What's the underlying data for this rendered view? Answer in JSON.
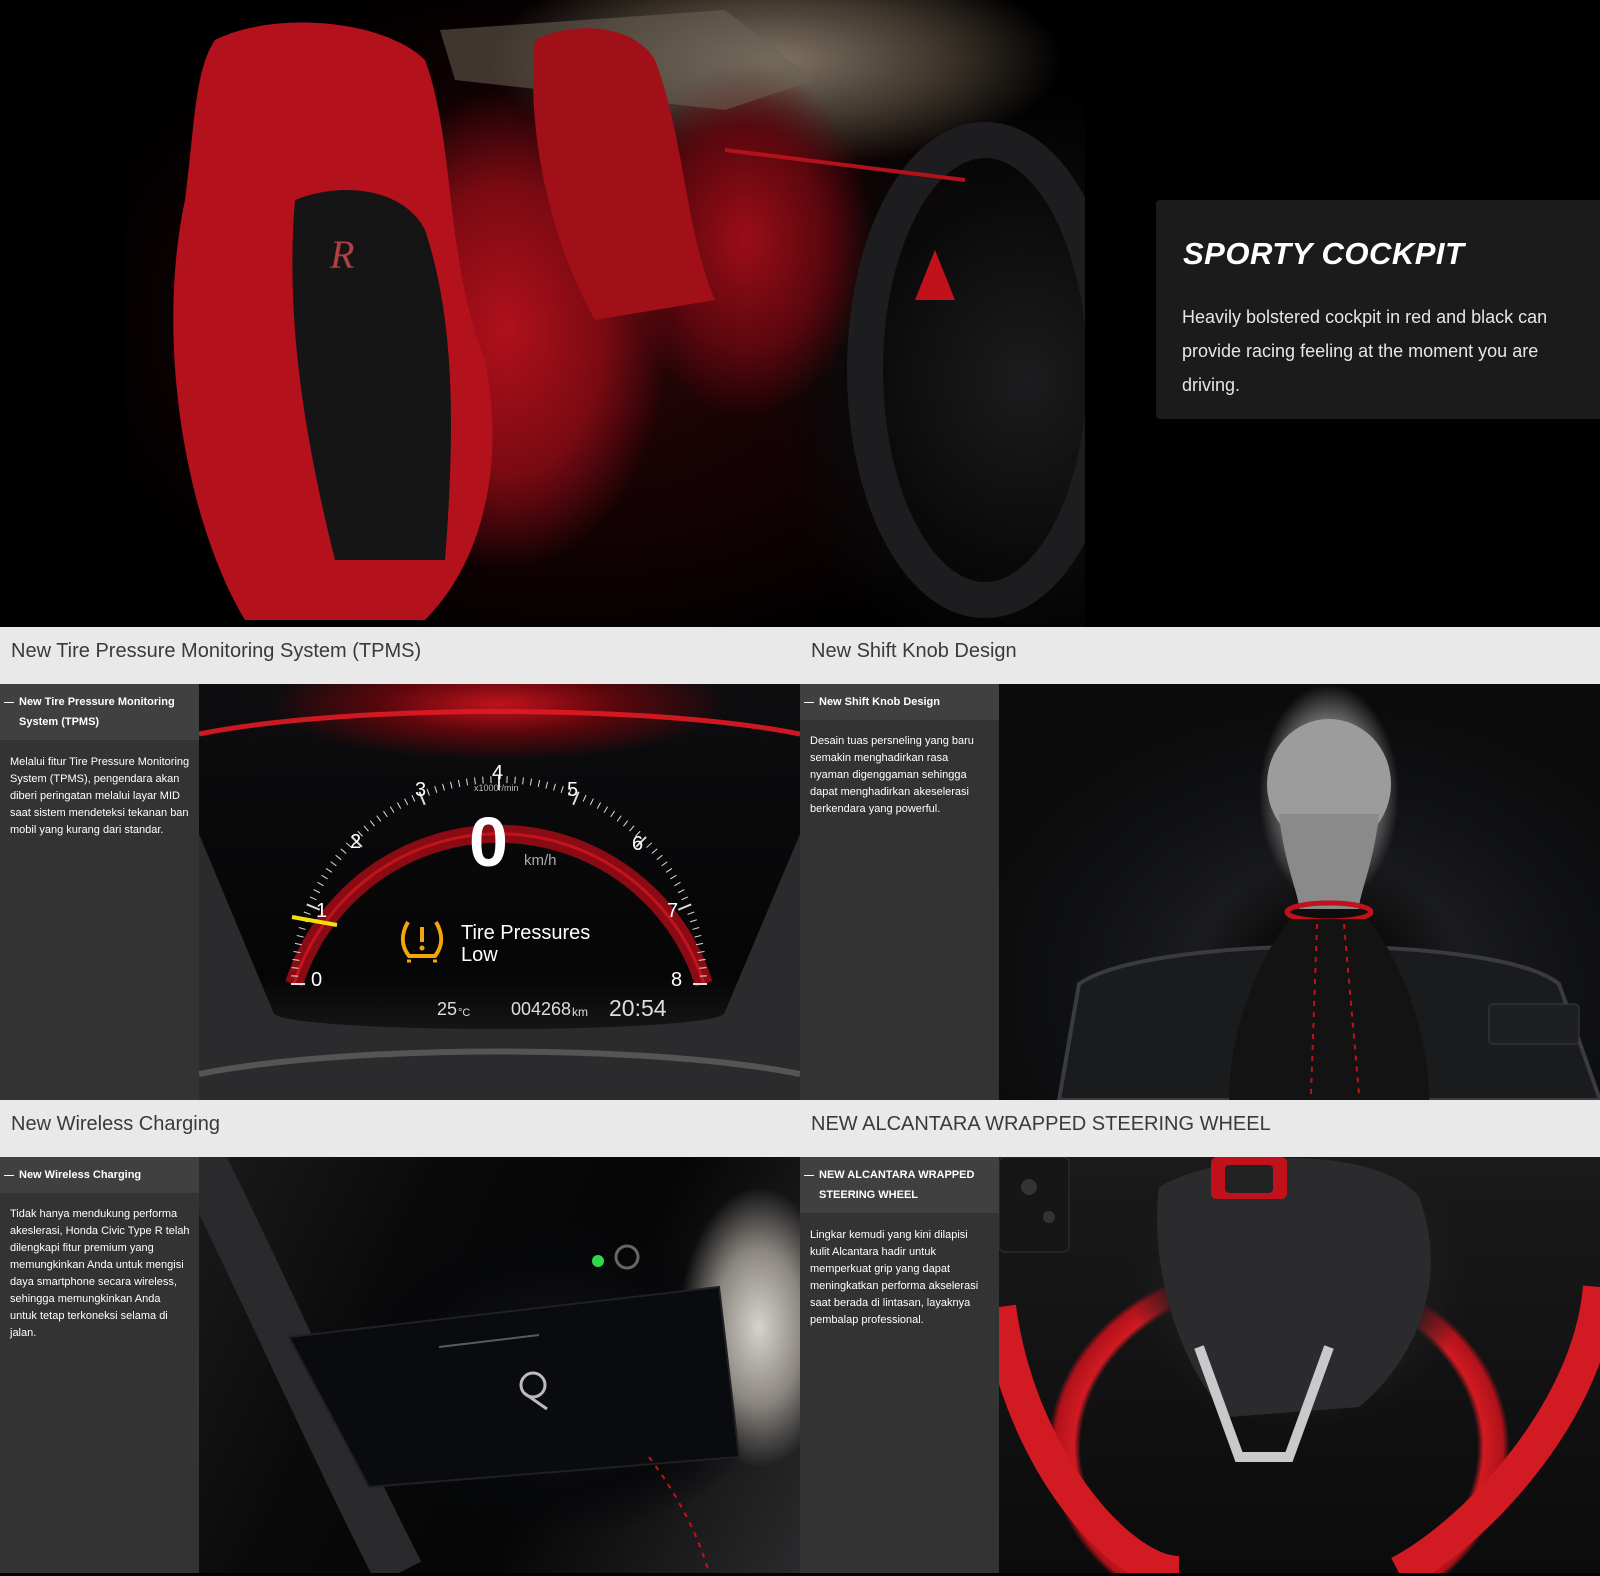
{
  "hero": {
    "title": "SPORTY COCKPIT",
    "description": "Heavily bolstered cockpit in red and black can provide racing feeling at the moment you are driving."
  },
  "features": [
    {
      "heading": "New Tire Pressure Monitoring System (TPMS)",
      "tab_label": "New Tire Pressure Monitoring System (TPMS)",
      "description": "Melalui fitur Tire Pressure Monitoring System (TPMS), pengendara akan diberi peringatan melalui layar MID saat sistem mendeteksi tekanan ban mobil yang kurang dari standar.",
      "cluster": {
        "speed": "0",
        "speed_unit": "km/h",
        "rpm_unit": "x1000r/min",
        "warning_line1": "Tire Pressures",
        "warning_line2": "Low",
        "temp": "25",
        "temp_unit": "°C",
        "odometer": "004268",
        "odometer_unit": "km",
        "clock": "20:54",
        "rpm_marks": [
          "0",
          "1",
          "2",
          "3",
          "4",
          "5",
          "6",
          "7",
          "8"
        ]
      }
    },
    {
      "heading": "New Shift Knob Design",
      "tab_label": "New Shift Knob Design",
      "description": "Desain tuas persneling yang baru semakin menghadirkan rasa nyaman digenggaman sehingga dapat menghadirkan akeselerasi berkendara yang powerful."
    },
    {
      "heading": "New Wireless Charging",
      "tab_label": "New Wireless Charging",
      "description": "Tidak hanya mendukung performa akeslerasi, Honda Civic Type R telah dilengkapi fitur premium yang memungkinkan Anda untuk mengisi daya smartphone secara wireless, sehingga memungkinkan Anda untuk tetap terkoneksi selama di jalan."
    },
    {
      "heading": "NEW ALCANTARA WRAPPED STEERING WHEEL",
      "tab_label": "NEW ALCANTARA WRAPPED STEERING WHEEL",
      "description": "Lingkar kemudi yang kini dilapisi kulit Alcantara hadir untuk memperkuat grip yang dapat meningkatkan performa akselerasi saat berada di lintasan, layaknya pembalap professional."
    }
  ],
  "colors": {
    "accent_red": "#d01620",
    "panel_dark": "#333333",
    "header_light": "#e9e9e9",
    "warning_amber": "#f2a60c"
  }
}
